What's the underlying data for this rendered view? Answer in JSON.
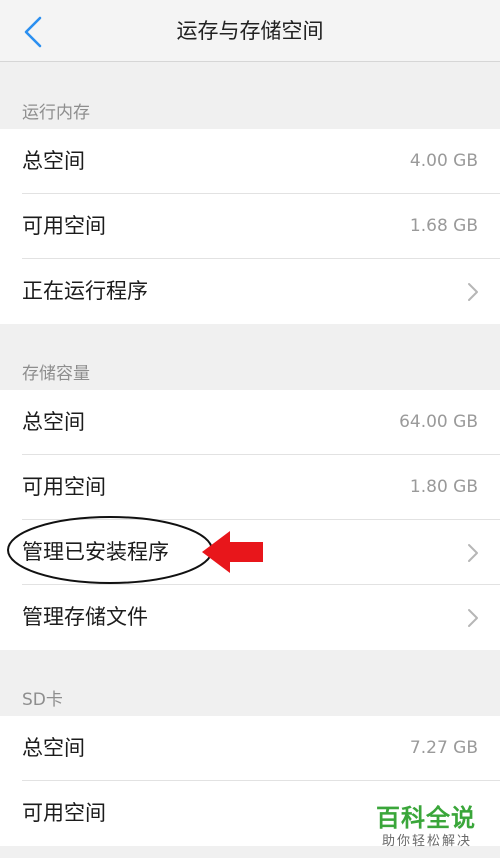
{
  "header": {
    "title": "运存与存储空间"
  },
  "sections": [
    {
      "title": "运行内存",
      "rows": [
        {
          "label": "总空间",
          "value": "4.00 GB"
        },
        {
          "label": "可用空间",
          "value": "1.68 GB"
        },
        {
          "label": "正在运行程序"
        }
      ]
    },
    {
      "title": "存储容量",
      "rows": [
        {
          "label": "总空间",
          "value": "64.00 GB"
        },
        {
          "label": "可用空间",
          "value": "1.80 GB"
        },
        {
          "label": "管理已安装程序"
        },
        {
          "label": "管理存储文件"
        }
      ]
    },
    {
      "title": "SD卡",
      "rows": [
        {
          "label": "总空间",
          "value": "7.27 GB"
        },
        {
          "label": "可用空间"
        }
      ]
    }
  ],
  "watermark": {
    "title": "百科全说",
    "subtitle": "助你轻松解决"
  },
  "colors": {
    "accent": "#2b8ff0",
    "annotation_arrow": "#e8161b",
    "watermark_green": "#3aa63a"
  }
}
